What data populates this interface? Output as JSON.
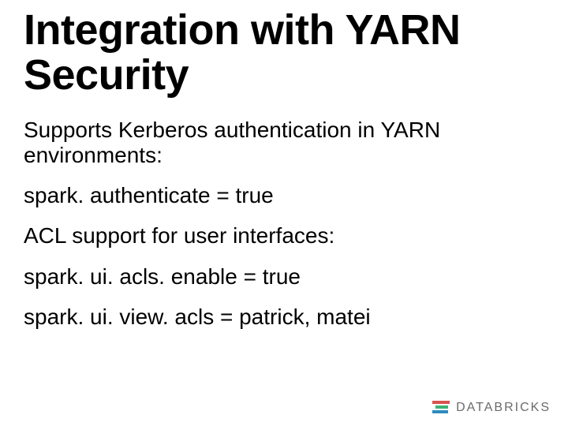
{
  "title": "Integration with YARN Security",
  "lines": {
    "l0": "Supports Kerberos authentication in YARN environments:",
    "l1": "spark. authenticate = true",
    "l2": "ACL support for user interfaces:",
    "l3": "spark. ui. acls. enable = true",
    "l4": "spark. ui. view. acls = patrick, matei"
  },
  "logo_text": "DATABRICKS"
}
